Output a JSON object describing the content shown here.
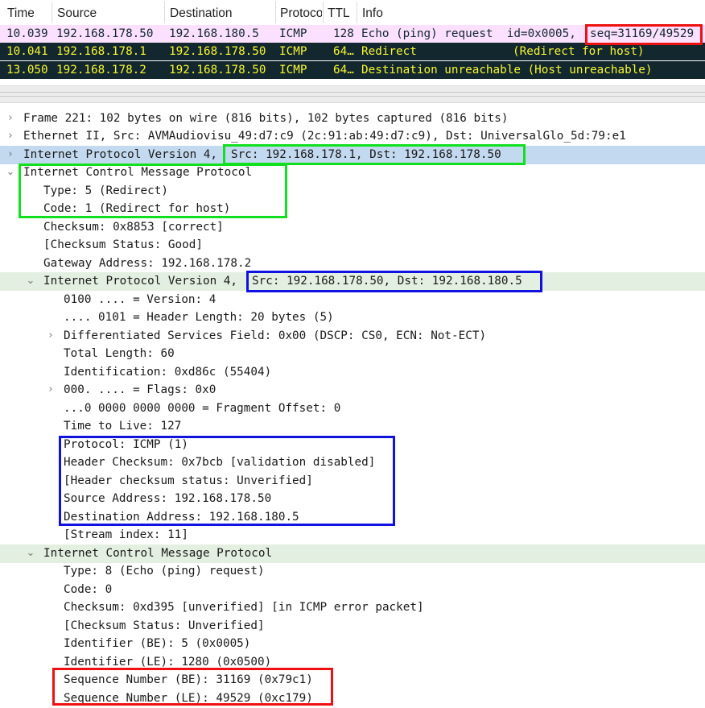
{
  "columns": [
    "Time",
    "Source",
    "Destination",
    "Protocol",
    "TTL",
    "Info"
  ],
  "packets": [
    {
      "time": "10.039",
      "source": "192.168.178.50",
      "destination": "192.168.180.5",
      "protocol": "ICMP",
      "ttl": "128",
      "info": "Echo (ping) request  id=0x0005,",
      "info_extra": "seq=31169/49529"
    },
    {
      "time": "10.041",
      "source": "192.168.178.1",
      "destination": "192.168.178.50",
      "protocol": "ICMP",
      "ttl": "64…",
      "info": "Redirect",
      "info_extra": "(Redirect for host)"
    },
    {
      "time": "13.050",
      "source": "192.168.178.2",
      "destination": "192.168.178.50",
      "protocol": "ICMP",
      "ttl": "64…",
      "info": "Destination unreachable (Host unreachable)",
      "info_extra": ""
    }
  ],
  "tree": {
    "frame": "Frame 221: 102 bytes on wire (816 bits), 102 bytes captured (816 bits)",
    "ethernet": "Ethernet II, Src: AVMAudiovisu_49:d7:c9 (2c:91:ab:49:d7:c9), Dst: UniversalGlo_5d:79:e1",
    "ip_outer": "Internet Protocol Version 4,",
    "ip_outer_addrs": "Src: 192.168.178.1, Dst: 192.168.178.50",
    "icmp_outer": "Internet Control Message Protocol",
    "icmp_type": "Type: 5 (Redirect)",
    "icmp_code": "Code: 1 (Redirect for host)",
    "icmp_checksum": "Checksum: 0x8853 [correct]",
    "icmp_checksum_status": "[Checksum Status: Good]",
    "gateway": "Gateway Address: 192.168.178.2",
    "ip_inner": "Internet Protocol Version 4,",
    "ip_inner_addrs": "Src: 192.168.178.50, Dst: 192.168.180.5",
    "version": "0100 .... = Version: 4",
    "header_length": ".... 0101 = Header Length: 20 bytes (5)",
    "dsfield": "Differentiated Services Field: 0x00 (DSCP: CS0, ECN: Not-ECT)",
    "total_length": "Total Length: 60",
    "identification": "Identification: 0xd86c (55404)",
    "flags": "000. .... = Flags: 0x0",
    "frag_offset": "...0 0000 0000 0000 = Fragment Offset: 0",
    "ttl": "Time to Live: 127",
    "protocol": "Protocol: ICMP (1)",
    "header_checksum": "Header Checksum: 0x7bcb [validation disabled]",
    "header_checksum_status": "[Header checksum status: Unverified]",
    "source_address": "Source Address: 192.168.178.50",
    "destination_address": "Destination Address: 192.168.180.5",
    "stream_index": "[Stream index: 11]",
    "icmp_inner": "Internet Control Message Protocol",
    "inner_type": "Type: 8 (Echo (ping) request)",
    "inner_code": "Code: 0",
    "inner_checksum": "Checksum: 0xd395 [unverified] [in ICMP error packet]",
    "inner_checksum_status": "[Checksum Status: Unverified]",
    "identifier_be": "Identifier (BE): 5 (0x0005)",
    "identifier_le": "Identifier (LE): 1280 (0x0500)",
    "seq_be": "Sequence Number (BE): 31169 (0x79c1)",
    "seq_le": "Sequence Number (LE): 49529 (0xc179)"
  },
  "icons": {
    "collapsed": "chevron-right-icon",
    "expanded": "chevron-down-icon"
  },
  "colors": {
    "selected_row_bg": "#fce0ff",
    "dark_row_bg": "#12272e",
    "dark_row_text": "#f7f632",
    "highlight_green": "#11e021",
    "highlight_blue": "#1212e0",
    "highlight_red": "#ee1111"
  }
}
